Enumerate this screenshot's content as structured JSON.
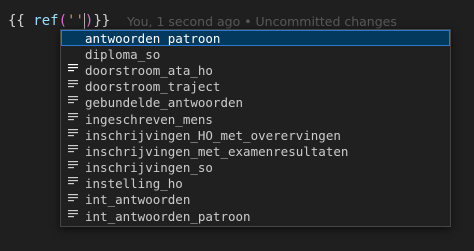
{
  "editor": {
    "code": {
      "open_braces": "{{ ",
      "func_name": "ref",
      "open_paren": "(",
      "string_quotes": "''",
      "close_paren": ")",
      "close_braces": "}}"
    },
    "blame": "You, 1 second ago • Uncommitted changes"
  },
  "suggestions": {
    "icon": "text-word-icon",
    "selected_index": 0,
    "items": [
      {
        "label": "antwoorden_patroon"
      },
      {
        "label": "diploma_so"
      },
      {
        "label": "doorstroom_ata_ho"
      },
      {
        "label": "doorstroom_traject"
      },
      {
        "label": "gebundelde_antwoorden"
      },
      {
        "label": "ingeschreven_mens"
      },
      {
        "label": "inschrijvingen_HO_met_overervingen"
      },
      {
        "label": "inschrijvingen_met_examenresultaten"
      },
      {
        "label": "inschrijvingen_so"
      },
      {
        "label": "instelling_ho"
      },
      {
        "label": "int_antwoorden"
      },
      {
        "label": "int_antwoorden_patroon"
      }
    ]
  },
  "colors": {
    "background": "#1f1f1f",
    "selection": "#04395e",
    "selection_border": "#2b79d0",
    "blame_text": "#5a5a5a"
  }
}
